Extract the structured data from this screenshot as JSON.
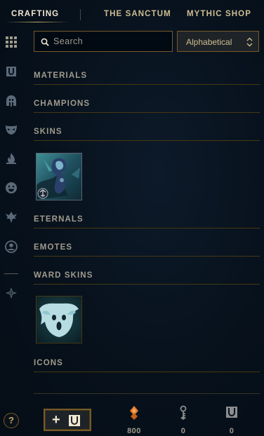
{
  "nav": {
    "tabs": [
      {
        "label": "CRAFTING",
        "active": true
      },
      {
        "label": "THE SANCTUM",
        "active": false
      },
      {
        "label": "MYTHIC SHOP",
        "active": false
      }
    ]
  },
  "sidebar": {
    "items": [
      {
        "icon": "grid-icon"
      },
      {
        "icon": "chest-icon"
      },
      {
        "icon": "champion-helmet-icon"
      },
      {
        "icon": "mask-icon"
      },
      {
        "icon": "flame-icon"
      },
      {
        "icon": "emote-icon"
      },
      {
        "icon": "ward-icon"
      },
      {
        "icon": "profile-icon"
      },
      {
        "icon": "skin-augment-icon"
      }
    ]
  },
  "search": {
    "placeholder": "Search"
  },
  "sort": {
    "value": "Alphabetical"
  },
  "categories": {
    "materials": "MATERIALS",
    "champions": "CHAMPIONS",
    "skins": "SKINS",
    "eternals": "ETERNALS",
    "emotes": "EMOTES",
    "ward_skins": "WARD SKINS",
    "icons": "ICONS"
  },
  "footer": {
    "help_label": "?",
    "add_label": "+",
    "orange_essence": "800",
    "keys": "0",
    "chests": "0"
  },
  "colors": {
    "gold": "#c8aa6e",
    "gold_dark": "#785a28",
    "text": "#a09b8c",
    "essence_orange": "#e07a2b"
  }
}
